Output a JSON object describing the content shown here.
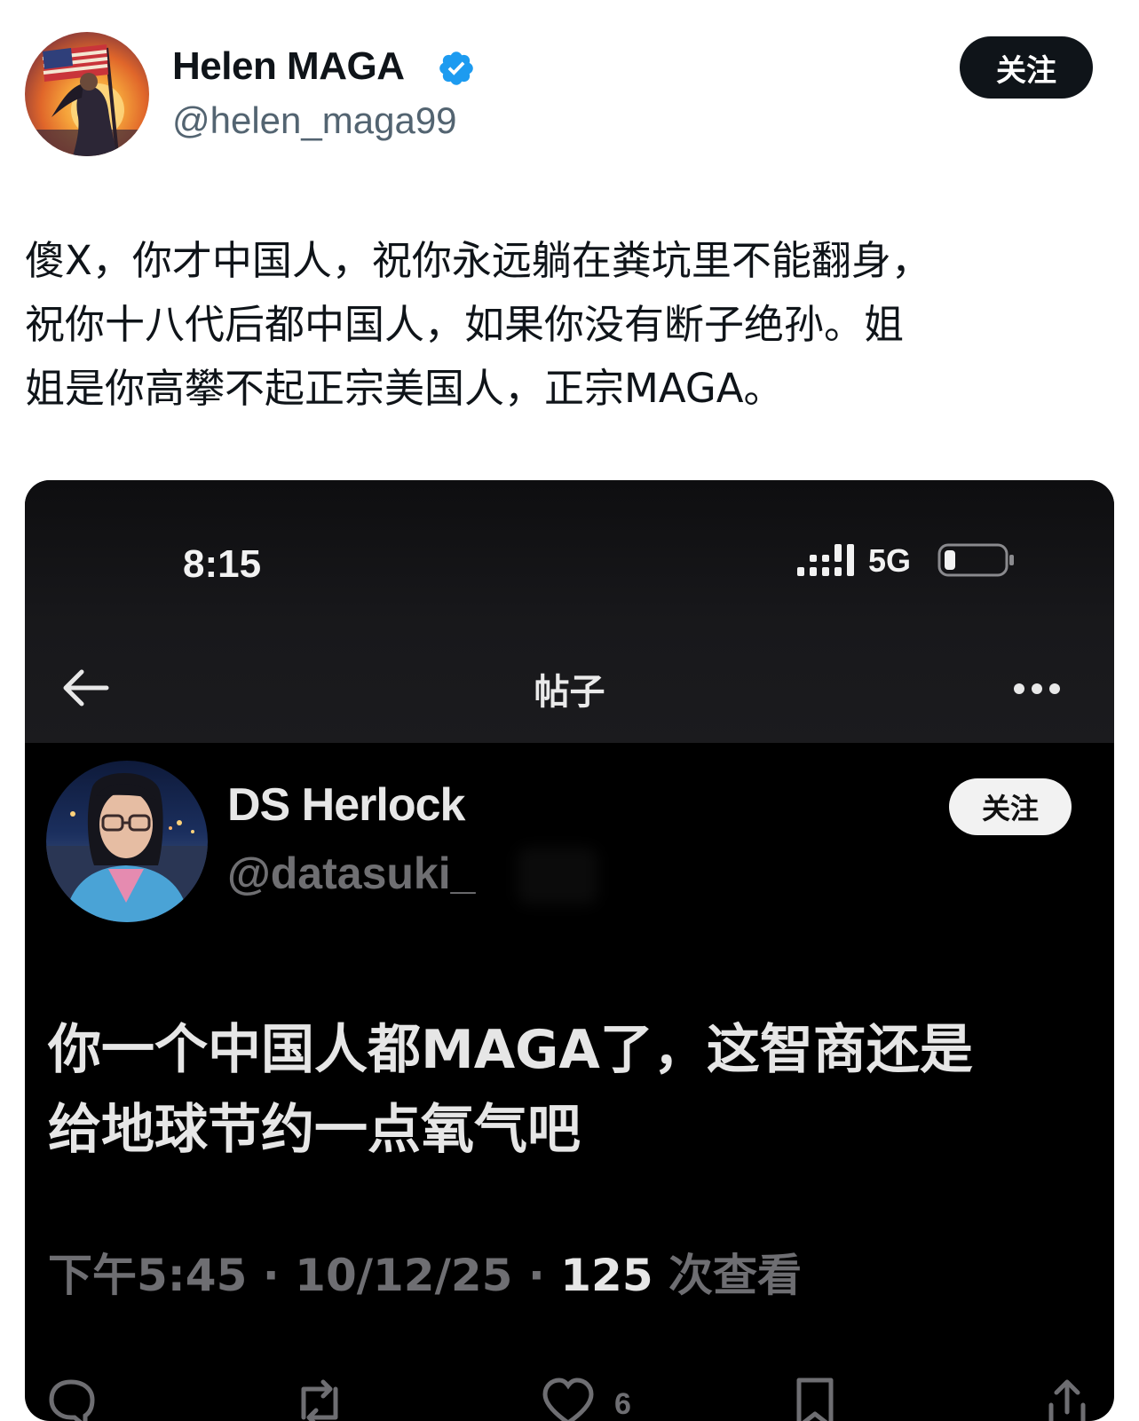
{
  "post": {
    "display_name": "Helen MAGA",
    "handle": "@helen_maga99",
    "follow_label": "关注",
    "text": "傻X，你才中国人，祝你永远躺在粪坑里不能翻身，\n祝你十八代后都中国人，如果你没有断子绝孙。姐\n姐是你高攀不起正宗美国人，正宗MAGA。"
  },
  "embedded_screenshot": {
    "status_bar": {
      "time": "8:15",
      "network": "5G"
    },
    "nav": {
      "title": "帖子"
    },
    "tweet": {
      "display_name": "DS Herlock",
      "handle": "@datasuki_",
      "follow_label": "关注",
      "text": "你一个中国人都MAGA了，这智商还是\n给地球节约一点氧气吧",
      "meta_prefix": "下午5:45 · 10/12/25 · ",
      "views_count": "125",
      "views_label": " 次查看",
      "likes": "6"
    }
  },
  "colors": {
    "verified_blue": "#1d9bf0",
    "dark_bg": "#000000",
    "follow_dark": "#0f1419"
  }
}
